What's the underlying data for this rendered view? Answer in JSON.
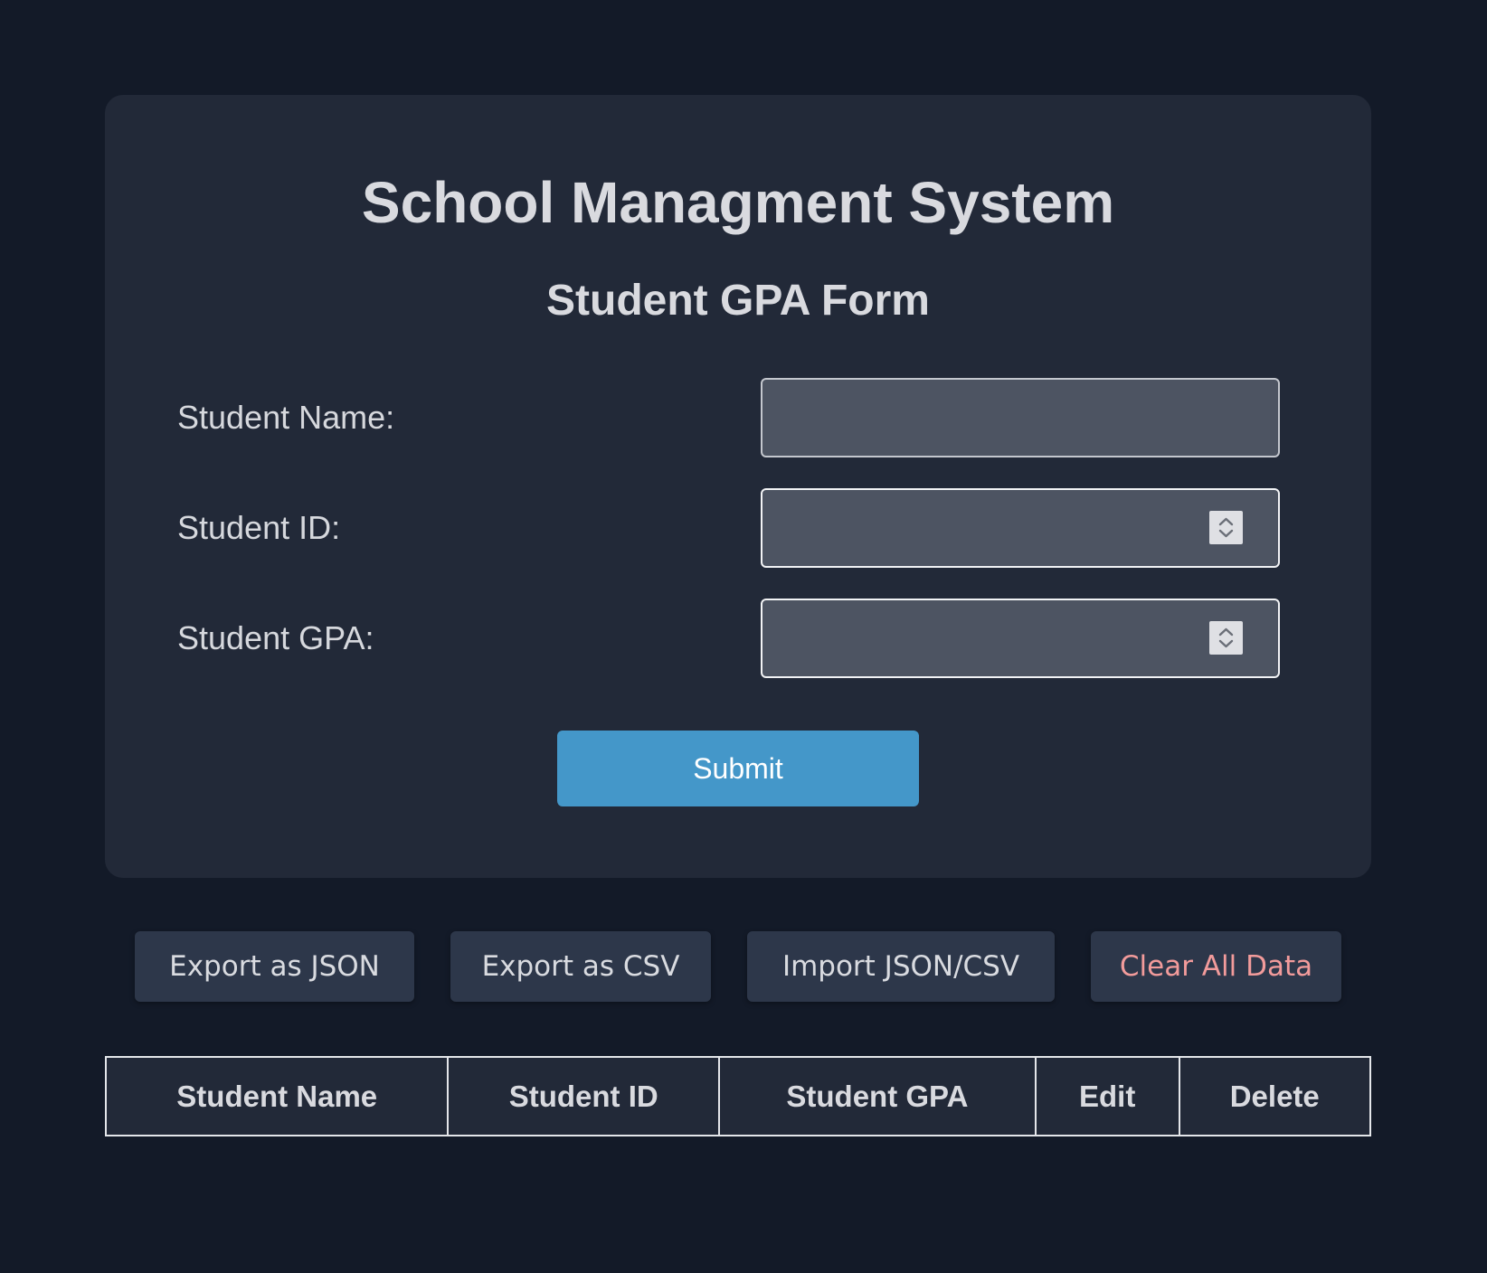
{
  "header": {
    "title": "School Managment System",
    "subtitle": "Student GPA Form"
  },
  "form": {
    "name_label": "Student Name:",
    "id_label": "Student ID:",
    "gpa_label": "Student GPA:",
    "name_value": "",
    "id_value": "",
    "gpa_value": "",
    "submit_label": "Submit"
  },
  "actions": {
    "export_json": "Export as JSON",
    "export_csv": "Export as CSV",
    "import": "Import JSON/CSV",
    "clear": "Clear All Data"
  },
  "table": {
    "columns": [
      "Student Name",
      "Student ID",
      "Student GPA",
      "Edit",
      "Delete"
    ],
    "rows": []
  },
  "colors": {
    "background": "#131a28",
    "card": "#222938",
    "accent": "#4497c9",
    "danger_text": "#f29b9b"
  },
  "icons": {
    "spinner": "number-spinner-icon"
  }
}
